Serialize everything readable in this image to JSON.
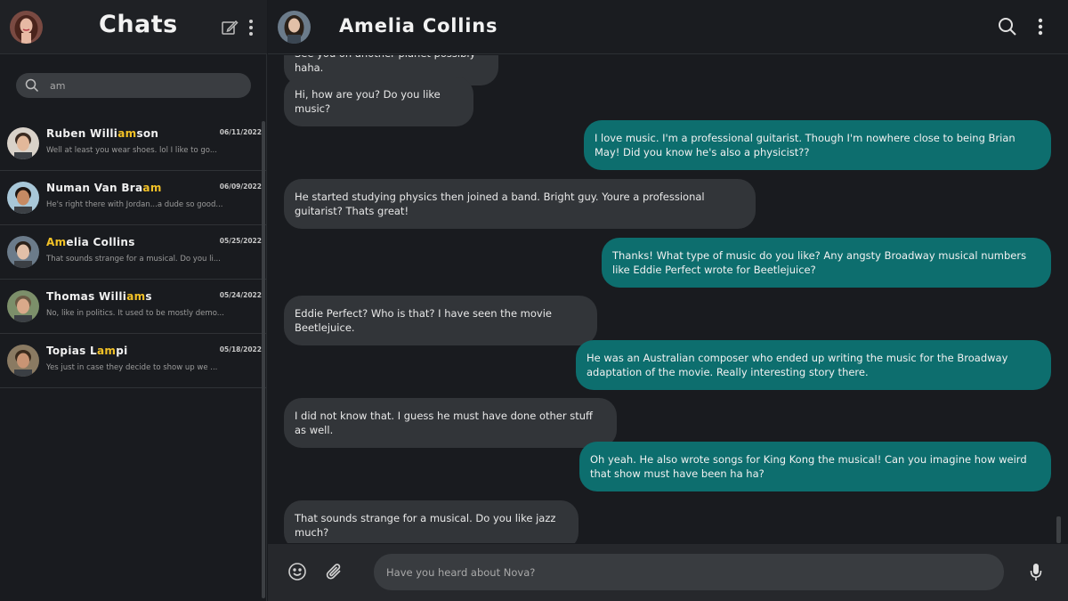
{
  "sidebar": {
    "title": "Chats",
    "search_value": "am",
    "chats": [
      {
        "name_pre": "Ruben Willi",
        "name_hl": "am",
        "name_post": "son",
        "preview": "Well at least you wear shoes.  lol I like to go...",
        "date": "06/11/2022",
        "avatar_bg": "#d9d2c9",
        "avatar_hair": "#3a2a20",
        "avatar_skin": "#e2b89a"
      },
      {
        "name_pre": "Numan Van Bra",
        "name_hl": "am",
        "name_post": "",
        "preview": "He's right there with Jordan...a dude so good...",
        "date": "06/09/2022",
        "avatar_bg": "#a8c7d8",
        "avatar_hair": "#1d1511",
        "avatar_skin": "#c68a63"
      },
      {
        "name_pre": "",
        "name_hl": "Am",
        "name_post": "elia Collins",
        "preview": "That sounds strange for a musical.  Do you li...",
        "date": "05/25/2022",
        "avatar_bg": "#6b7b8a",
        "avatar_hair": "#2b2119",
        "avatar_skin": "#e2c0a8"
      },
      {
        "name_pre": "Thomas Willi",
        "name_hl": "am",
        "name_post": "s",
        "preview": "No, like in politics. It used to be mostly demo...",
        "date": "05/24/2022",
        "avatar_bg": "#7c8f6a",
        "avatar_hair": "#6b5a44",
        "avatar_skin": "#d9a98a"
      },
      {
        "name_pre": "Topias L",
        "name_hl": "am",
        "name_post": "pi",
        "preview": "Yes just in case they decide to show up we ...",
        "date": "05/18/2022",
        "avatar_bg": "#8a7a62",
        "avatar_hair": "#3a2a1c",
        "avatar_skin": "#c99474"
      }
    ]
  },
  "conversation": {
    "contact_name": "Amelia Collins",
    "composer_value": "Have you heard about Nova?",
    "messages": [
      {
        "dir": "in",
        "text": "See you on another planet possibly haha."
      },
      {
        "dir": "in",
        "text": "Hi, how are you? Do you like music?"
      },
      {
        "dir": "out",
        "text": "I love music. I'm a professional guitarist. Though I'm nowhere close to being Brian May! Did you know he's also a physicist??"
      },
      {
        "dir": "in",
        "text": "He started studying physics then joined a band. Bright guy. Youre a professional guitarist? Thats great!"
      },
      {
        "dir": "out",
        "text": "Thanks! What type of music do you like? Any angsty Broadway musical numbers like Eddie Perfect wrote for Beetlejuice?"
      },
      {
        "dir": "in",
        "text": "Eddie Perfect? Who is that? I have seen the movie Beetlejuice."
      },
      {
        "dir": "out",
        "text": "He was an Australian composer who ended up writing the music for the Broadway adaptation of the movie. Really interesting story there."
      },
      {
        "dir": "in",
        "text": "I did not know that. I guess he must have done other stuff as well."
      },
      {
        "dir": "out",
        "text": "Oh yeah. He also wrote songs for King Kong the musical! Can you imagine how weird that show must have been ha ha?"
      },
      {
        "dir": "in",
        "text": "That sounds strange for a musical.  Do you like jazz much?"
      }
    ]
  },
  "colors": {
    "accent_highlight": "#f3c227",
    "outgoing_bubble": "#0d6e6e",
    "incoming_bubble": "#323539"
  }
}
